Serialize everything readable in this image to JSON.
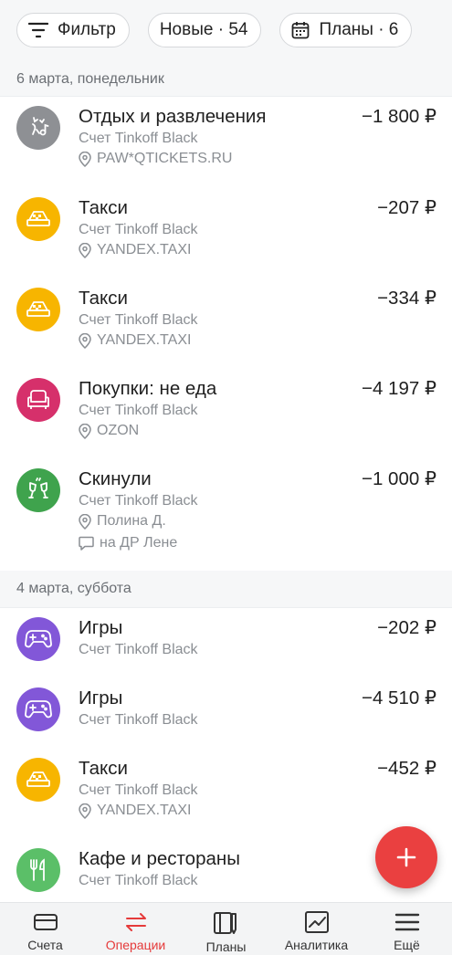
{
  "filters": {
    "filter_label": "Фильтр",
    "new_label": "Новые · 54",
    "plans_label": "Планы · 6"
  },
  "sections": [
    {
      "date": "6 марта, понедельник",
      "operations": [
        {
          "title": "Отдых и развлечения",
          "account": "Счет Tinkoff Black",
          "place": "PAW*QTICKETS.RU",
          "amount": "−1 800 ₽",
          "icon": "entertainment-icon",
          "color": "#8e9094"
        },
        {
          "title": "Такси",
          "account": "Счет Tinkoff Black",
          "place": "YANDEX.TAXI",
          "amount": "−207 ₽",
          "icon": "taxi-icon",
          "color": "#f7b500"
        },
        {
          "title": "Такси",
          "account": "Счет Tinkoff Black",
          "place": "YANDEX.TAXI",
          "amount": "−334 ₽",
          "icon": "taxi-icon",
          "color": "#f7b500"
        },
        {
          "title": "Покупки: не еда",
          "account": "Счет Tinkoff Black",
          "place": "OZON",
          "amount": "−4 197 ₽",
          "icon": "armchair-icon",
          "color": "#d6306b"
        },
        {
          "title": "Скинули",
          "account": "Счет Tinkoff Black",
          "place": "Полина Д.",
          "comment": "на ДР Лене",
          "amount": "−1 000 ₽",
          "icon": "glasses-cheers-icon",
          "color": "#3fa34d"
        }
      ]
    },
    {
      "date": "4 марта, суббота",
      "operations": [
        {
          "title": "Игры",
          "account": "Счет Tinkoff Black",
          "amount": "−202 ₽",
          "icon": "gamepad-icon",
          "color": "#8257d8"
        },
        {
          "title": "Игры",
          "account": "Счет Tinkoff Black",
          "amount": "−4 510 ₽",
          "icon": "gamepad-icon",
          "color": "#8257d8"
        },
        {
          "title": "Такси",
          "account": "Счет Tinkoff Black",
          "place": "YANDEX.TAXI",
          "amount": "−452 ₽",
          "icon": "taxi-icon",
          "color": "#f7b500"
        },
        {
          "title": "Кафе и рестораны",
          "account": "Счет Tinkoff Black",
          "amount": "",
          "icon": "fork-knife-icon",
          "color": "#5bbf68"
        }
      ]
    }
  ],
  "fab": {
    "icon": "plus-icon",
    "color": "#ea4040"
  },
  "tabbar": {
    "items": [
      {
        "label": "Счета",
        "icon": "card-icon"
      },
      {
        "label": "Операции",
        "icon": "arrows-swap-icon",
        "active": true
      },
      {
        "label": "Планы",
        "icon": "planner-icon"
      },
      {
        "label": "Аналитика",
        "icon": "chart-icon"
      },
      {
        "label": "Ещё",
        "icon": "menu-icon"
      }
    ],
    "accent": "#e53a3a"
  }
}
